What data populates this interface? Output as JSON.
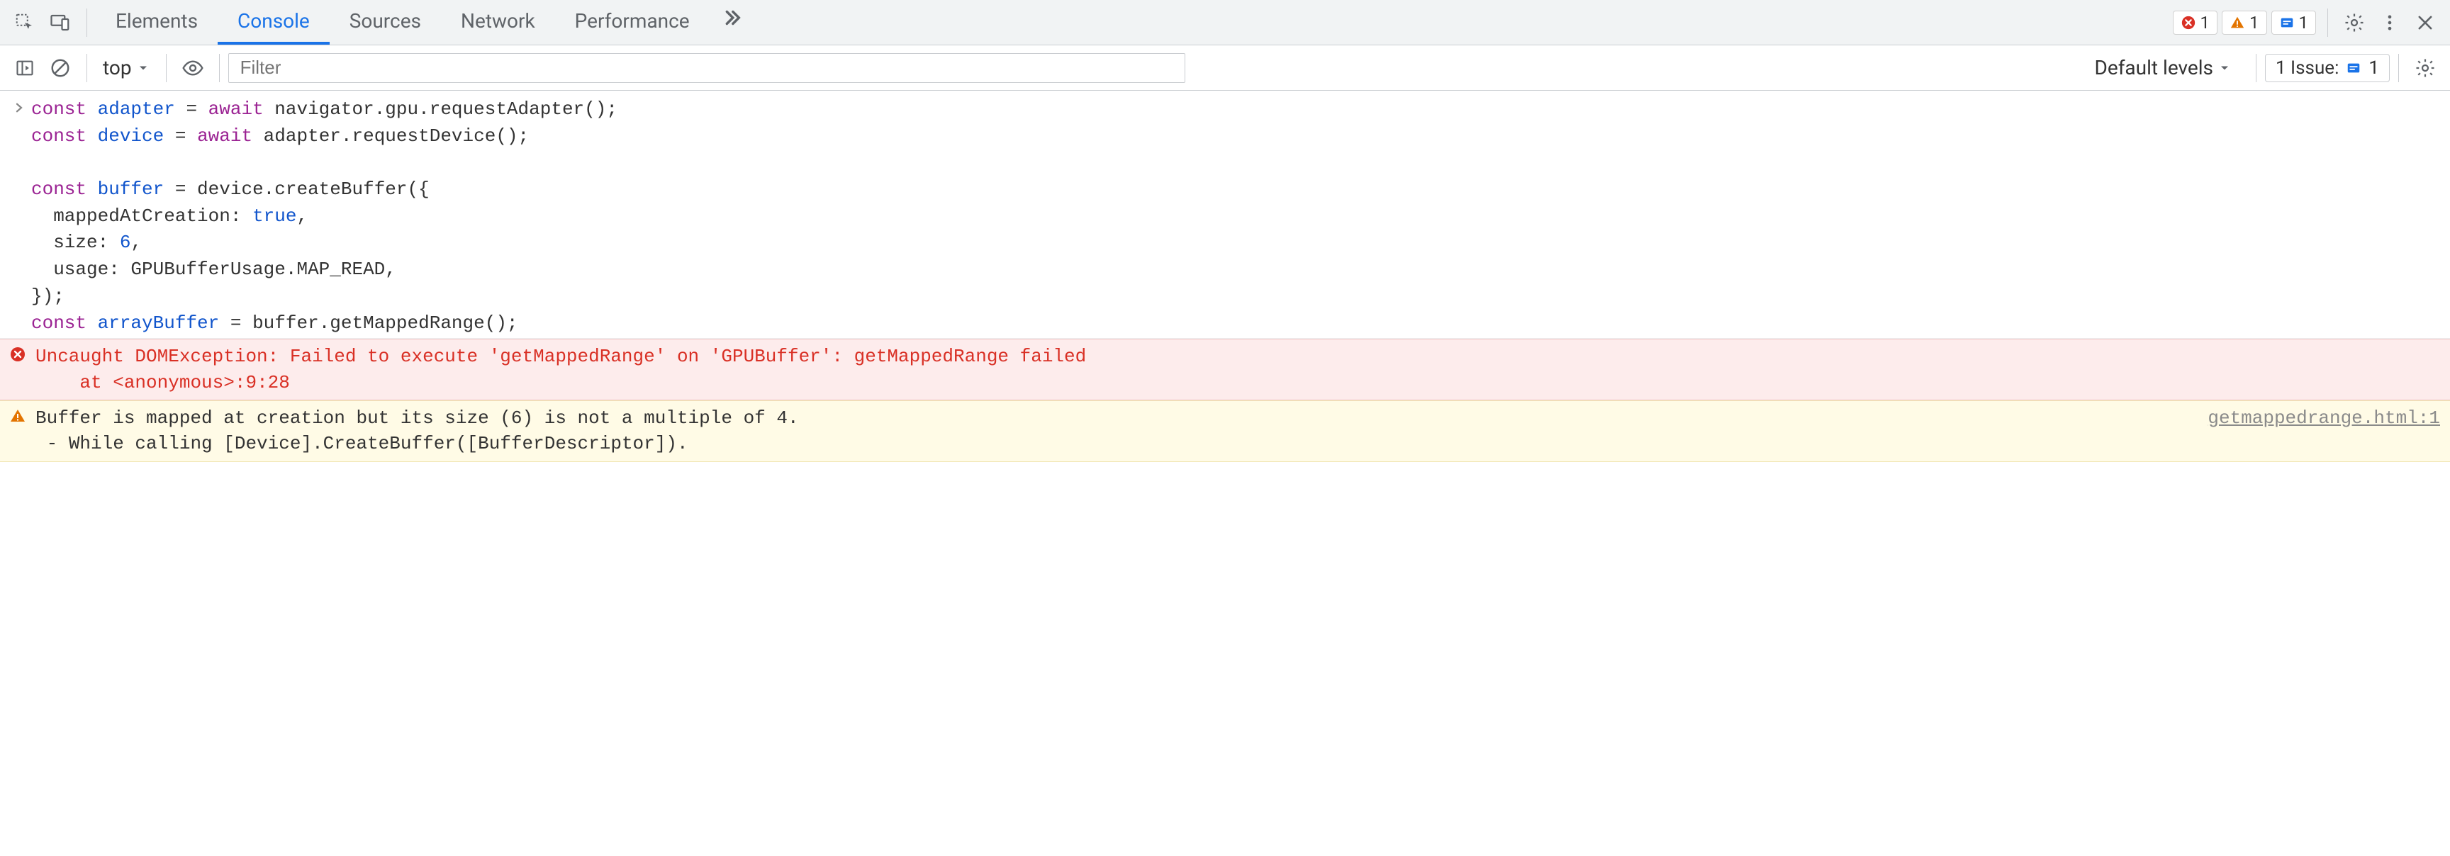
{
  "tabs": {
    "elements": "Elements",
    "console": "Console",
    "sources": "Sources",
    "network": "Network",
    "performance": "Performance"
  },
  "topbar": {
    "error_count": "1",
    "warn_count": "1",
    "info_count": "1"
  },
  "toolbar2": {
    "context": "top",
    "filter_placeholder": "Filter",
    "levels": "Default levels",
    "issues_label": "1 Issue:",
    "issues_count": "1"
  },
  "code": {
    "line1_kw1": "const",
    "line1_id": "adapter",
    "line1_eq": " = ",
    "line1_aw": "await",
    "line1_rest": " navigator.gpu.requestAdapter();",
    "line2_kw1": "const",
    "line2_id": "device",
    "line2_eq": " = ",
    "line2_aw": "await",
    "line2_rest": " adapter.requestDevice();",
    "blank": "",
    "line4_kw1": "const",
    "line4_id": "buffer",
    "line4_rest": " = device.createBuffer({",
    "line5_key": "  mappedAtCreation: ",
    "line5_val": "true",
    "line5_end": ",",
    "line6_key": "  size: ",
    "line6_val": "6",
    "line6_end": ",",
    "line7": "  usage: GPUBufferUsage.MAP_READ,",
    "line8": "});",
    "line9_kw1": "const",
    "line9_id": "arrayBuffer",
    "line9_rest": " = buffer.getMappedRange();"
  },
  "error": {
    "text": "Uncaught DOMException: Failed to execute 'getMappedRange' on 'GPUBuffer': getMappedRange failed\n    at <anonymous>:9:28"
  },
  "warn": {
    "text": "Buffer is mapped at creation but its size (6) is not a multiple of 4.\n - While calling [Device].CreateBuffer([BufferDescriptor]).",
    "src": "getmappedrange.html:1"
  }
}
